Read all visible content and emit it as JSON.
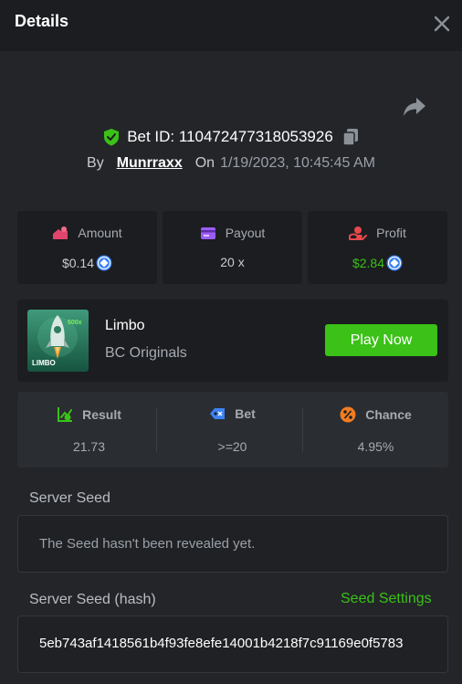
{
  "header": {
    "title": "Details"
  },
  "bet": {
    "id_label": "Bet ID: 110472477318053926",
    "by_label": "By",
    "username": "Munrraxx",
    "on_label": "On",
    "datetime": "1/19/2023, 10:45:45 AM"
  },
  "stats": [
    {
      "label": "Amount",
      "value": "$0.14",
      "icon": "amount-icon"
    },
    {
      "label": "Payout",
      "value": "20 x",
      "icon": "payout-icon"
    },
    {
      "label": "Profit",
      "value": "$2.84",
      "icon": "profit-icon"
    }
  ],
  "game": {
    "name": "Limbo",
    "provider": "BC Originals",
    "thumb_multiplier": "500x",
    "thumb_title": "LIMBO",
    "play_label": "Play Now"
  },
  "results": [
    {
      "label": "Result",
      "value": "21.73",
      "icon": "result-icon"
    },
    {
      "label": "Bet",
      "value": ">=20",
      "icon": "bet-tag-icon"
    },
    {
      "label": "Chance",
      "value": "4.95%",
      "icon": "percent-icon"
    }
  ],
  "server_seed": {
    "label": "Server Seed",
    "message": "The Seed hasn't been revealed yet."
  },
  "server_seed_hash": {
    "label": "Server Seed (hash)",
    "settings_link": "Seed Settings",
    "value": "5eb743af1418561b4f93fe8efe14001b4218f7c91169e0f5783"
  },
  "colors": {
    "accent_green": "#3bc117",
    "background": "#232529",
    "card": "#1b1d20",
    "coin_blue": "#3b82f6"
  }
}
